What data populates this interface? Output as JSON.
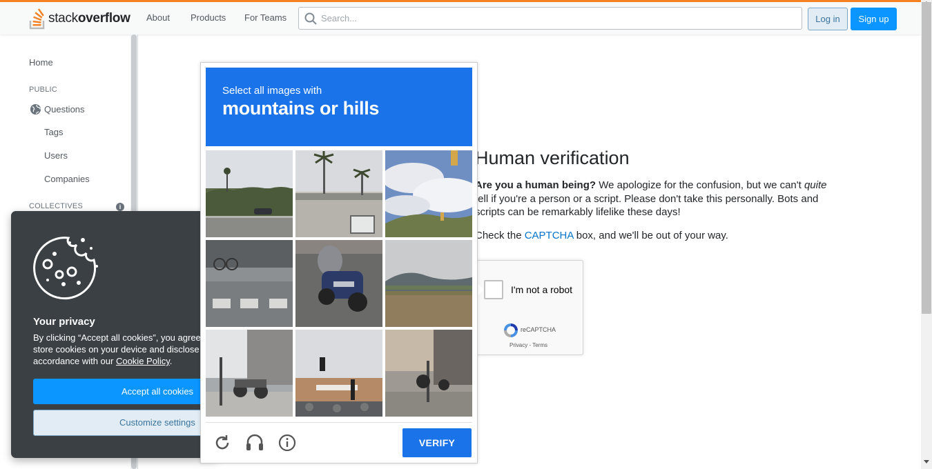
{
  "header": {
    "logo": {
      "text_regular": "stack",
      "text_bold": "overflow"
    },
    "nav": [
      "About",
      "Products",
      "For Teams"
    ],
    "search": {
      "placeholder": "Search...",
      "value": ""
    },
    "login_label": "Log in",
    "signup_label": "Sign up",
    "accent_color": "#f48225"
  },
  "sidebar": {
    "home": "Home",
    "public_heading": "PUBLIC",
    "items": [
      "Questions",
      "Tags",
      "Users",
      "Companies"
    ],
    "collectives_heading": "COLLECTIVES",
    "info_icon": "i"
  },
  "verification": {
    "title": "Human verification",
    "lead_bold": "Are you a human being?",
    "lead_text_1": " We apologize for the confusion, but we can't ",
    "lead_italic": "quite",
    "lead_text_2": " tell if you're a person or a script. Please don't take this personally. Bots and scripts can be remarkably lifelike these days!",
    "check_prefix": "Check the ",
    "check_link": "CAPTCHA",
    "check_suffix": " box, and we'll be out of your way."
  },
  "recaptcha_widget": {
    "label": "I'm not a robot",
    "brand": "reCAPTCHA",
    "privacy": "Privacy",
    "separator": " - ",
    "terms": "Terms",
    "checked": false
  },
  "cookie_banner": {
    "title": "Your privacy",
    "text_1": "By clicking “Accept all cookies”, you agree",
    "text_2": "store cookies on your device and disclose",
    "text_3_prefix": "accordance with our ",
    "policy_link": "Cookie Policy",
    "text_3_suffix": ".",
    "accept_label": "Accept all cookies",
    "customize_label": "Customize settings"
  },
  "challenge": {
    "instruction": "Select all images with",
    "target": "mountains or hills",
    "header_color": "#1a73e8",
    "tiles": [
      {
        "name": "tile-road-palms",
        "selected": false
      },
      {
        "name": "tile-house-palms",
        "selected": false
      },
      {
        "name": "tile-clouds-traffic-light",
        "selected": false
      },
      {
        "name": "tile-crosswalk",
        "selected": false
      },
      {
        "name": "tile-motorcycle",
        "selected": false
      },
      {
        "name": "tile-hills-overpass",
        "selected": false
      },
      {
        "name": "tile-parked-motorcycles",
        "selected": false
      },
      {
        "name": "tile-traffic-light-store",
        "selected": false
      },
      {
        "name": "tile-sidewalk-scooter",
        "selected": false
      }
    ],
    "footer_icons": [
      "reload-icon",
      "audio-icon",
      "info-icon"
    ],
    "verify_label": "VERIFY"
  }
}
